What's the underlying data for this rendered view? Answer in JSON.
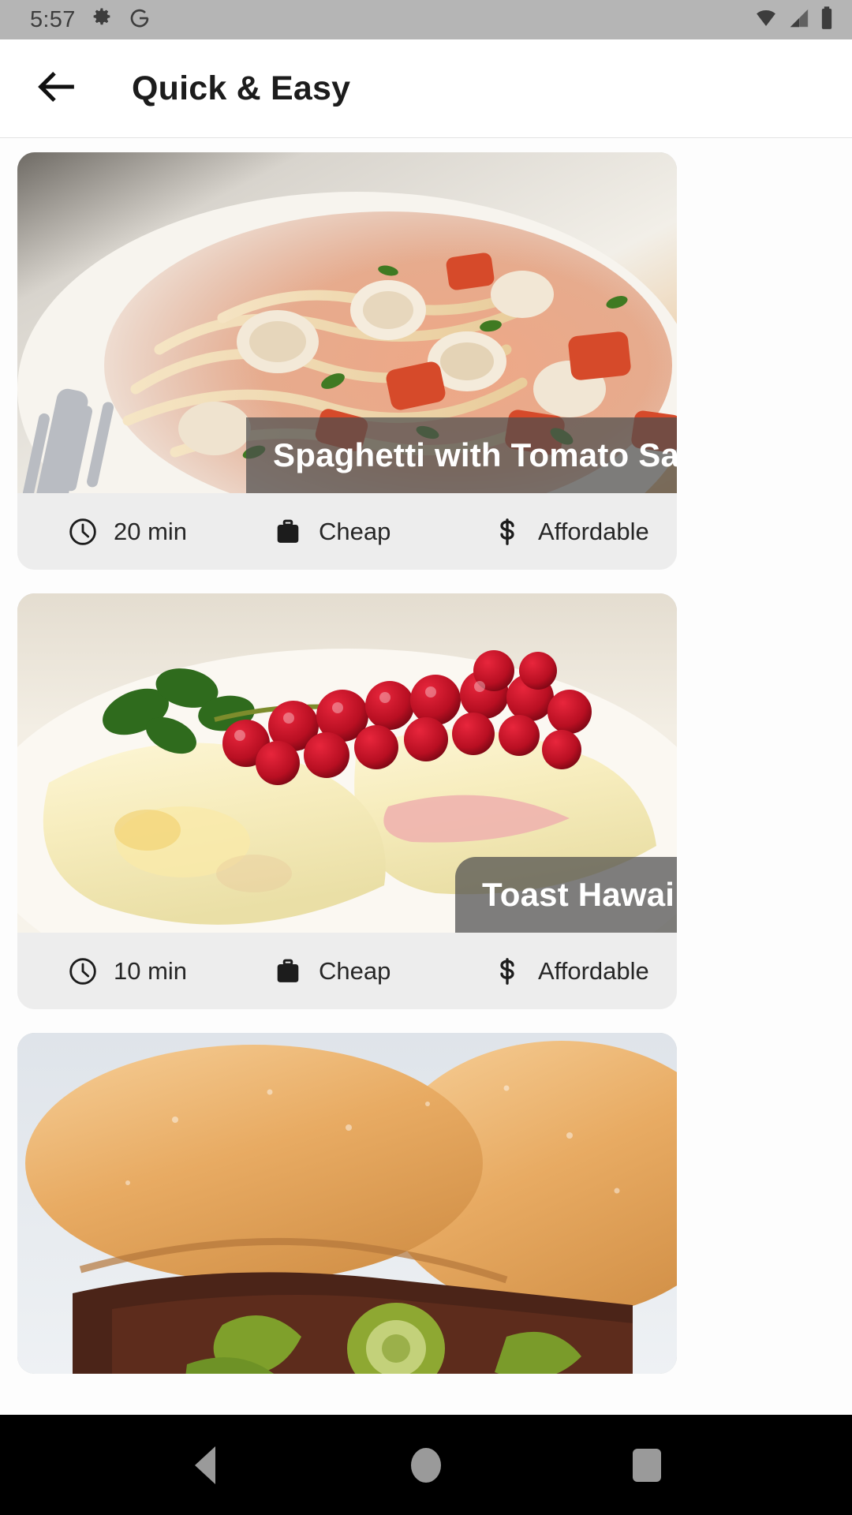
{
  "status_bar": {
    "time": "5:57",
    "icons_left": [
      "gear-icon",
      "google-g-icon"
    ],
    "icons_right": [
      "wifi-icon",
      "cellular-signal-icon",
      "battery-icon"
    ]
  },
  "app_bar": {
    "back_icon": "back-arrow-icon",
    "title": "Quick & Easy"
  },
  "recipes": [
    {
      "title": "Spaghetti with Tomato Sauce",
      "image_alt": "spaghetti with clams and tomato sauce on a white plate with fork",
      "time": "20 min",
      "effort": "Cheap",
      "cost": "Affordable",
      "time_icon": "clock-icon",
      "effort_icon": "briefcase-icon",
      "cost_icon": "dollar-icon"
    },
    {
      "title": "Toast Hawaii",
      "image_alt": "toast with melted cheese, ham and red currants on a white plate",
      "time": "10 min",
      "effort": "Cheap",
      "cost": "Affordable",
      "time_icon": "clock-icon",
      "effort_icon": "briefcase-icon",
      "cost_icon": "dollar-icon"
    },
    {
      "title": "",
      "image_alt": "two burger buns with grilled meat and jalapeno slices",
      "time": "",
      "effort": "",
      "cost": "",
      "time_icon": "clock-icon",
      "effort_icon": "briefcase-icon",
      "cost_icon": "dollar-icon"
    }
  ],
  "nav_bar": {
    "back_label": "back-triangle-icon",
    "home_label": "home-circle-icon",
    "recents_label": "recents-square-icon"
  },
  "colors": {
    "status_bar_bg": "#b5b5b5",
    "app_bar_bg": "#ffffff",
    "page_bg": "#fdfdfd",
    "card_meta_bg": "#ededed",
    "title_band_bg": "rgba(78,78,78,0.72)",
    "nav_bar_bg": "#000000",
    "nav_icon": "#9a9a9a",
    "text_primary": "#1c1c1c"
  }
}
